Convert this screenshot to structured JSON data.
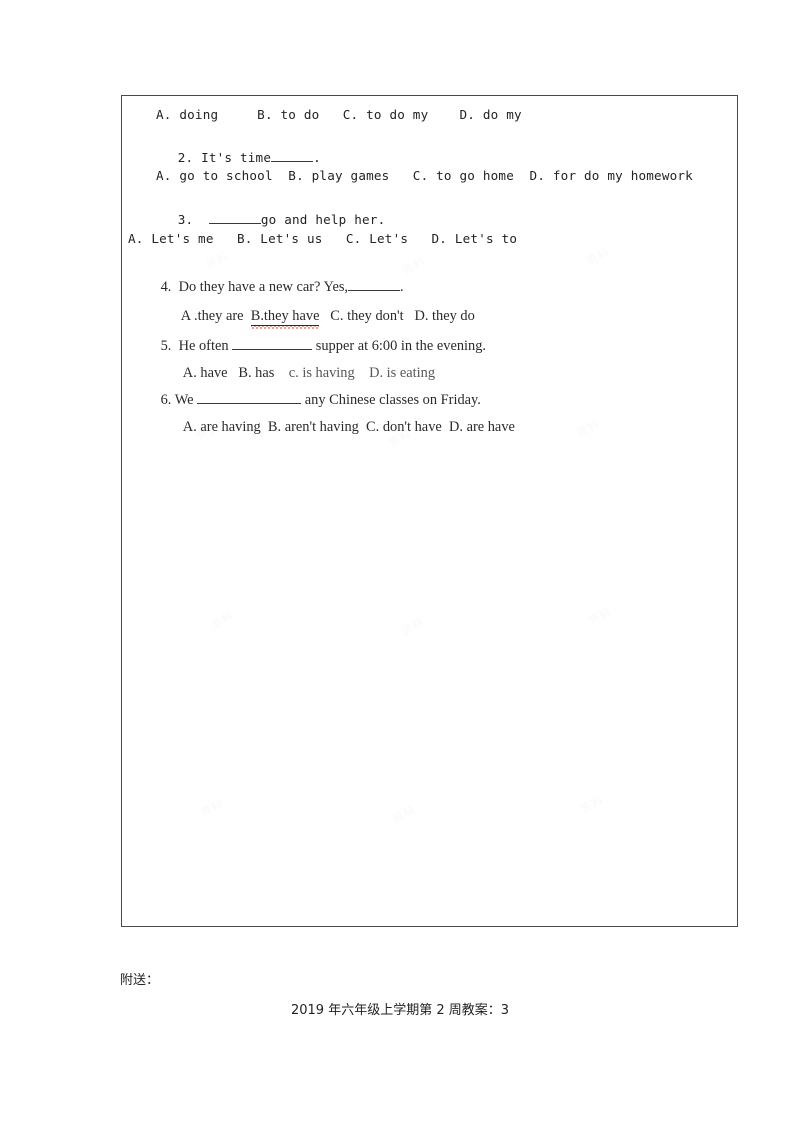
{
  "document": {
    "page_background": "#ffffff",
    "table_border_color": "#4a4a4d"
  },
  "watermarks": [
    "资料",
    "资料",
    "资料",
    "资料",
    "资料",
    "资料",
    "资料",
    "资料",
    "资料",
    "资料",
    "资料",
    "资料"
  ],
  "exercise": {
    "q1_options": "A. doing     B. to do   C. to do my    D. do my",
    "q2": {
      "number": "2.",
      "stem_before": "It's time",
      "stem_after": ".",
      "options": "A. go to school  B. play games   C. to go home  D. for do my homework"
    },
    "q3": {
      "number": "3.",
      "stem_after": "go and help her.",
      "options": "A. Let's me   B. Let's us   C. Let's   D. Let's to"
    },
    "q4": {
      "number": "4.",
      "stem_before": "Do they have a new car? Yes,",
      "stem_after": ".",
      "opt_a": "A .they are",
      "opt_b": "B.they have",
      "opt_c": "C. they don't",
      "opt_d": "D. they do",
      "marked_option": "B.they have",
      "marker_color": "#d83b2a"
    },
    "q5": {
      "number": "5.",
      "stem_before": "He often",
      "stem_after": "supper at 6:00 in the evening.",
      "opt_a": "A. have",
      "opt_b": "B. has",
      "opt_c": "c. is having",
      "opt_d": "D. is eating"
    },
    "q6": {
      "number": "6.",
      "stem_before": "We",
      "stem_after": "any Chinese classes on Friday.",
      "opt_a": "A. are having",
      "opt_b": "B. aren't having",
      "opt_c": "C. don't have",
      "opt_d": "D. are have"
    }
  },
  "footer": {
    "attachment_label": "附送：",
    "attachment_title": "2019 年六年级上学期第 2 周教案：3"
  }
}
